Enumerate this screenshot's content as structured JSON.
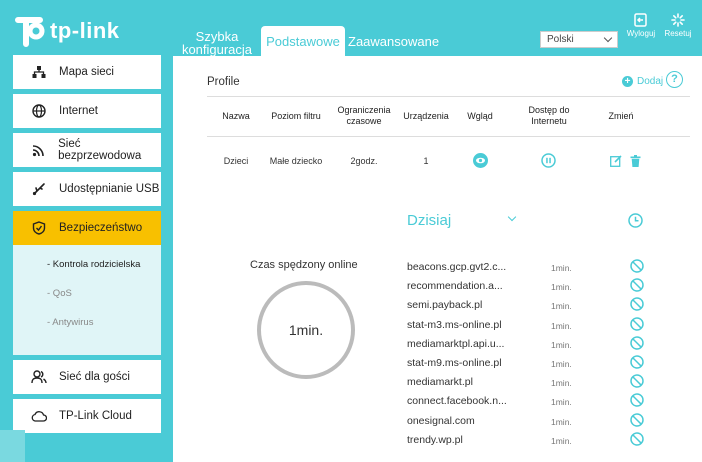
{
  "brand": {
    "name": "tp-link"
  },
  "topnav": {
    "quick_setup": "Szybka konfiguracja",
    "basic": "Podstawowe",
    "advanced": "Zaawansowane"
  },
  "language": {
    "selected": "Polski"
  },
  "header_buttons": {
    "logout": "Wyloguj",
    "reset": "Resetuj"
  },
  "sidebar": {
    "items": [
      {
        "label": "Mapa sieci",
        "icon": "network-map-icon"
      },
      {
        "label": "Internet",
        "icon": "globe-icon"
      },
      {
        "label": "Sieć bezprzewodowa",
        "icon": "wifi-icon"
      },
      {
        "label": "Udostępnianie USB",
        "icon": "usb-icon"
      },
      {
        "label": "Bezpieczeństwo",
        "icon": "shield-icon"
      },
      {
        "label": "Sieć dla gości",
        "icon": "guests-icon"
      },
      {
        "label": "TP-Link Cloud",
        "icon": "cloud-icon"
      }
    ],
    "subitems": [
      "- Kontrola rodzicielska",
      "- QoS",
      "- Antywirus"
    ]
  },
  "profiles": {
    "title": "Profile",
    "add_label": "Dodaj",
    "columns": [
      "Nazwa",
      "Poziom filtru",
      "Ograniczenia czasowe",
      "Urządzenia",
      "Wgląd",
      "Dostęp do Internetu",
      "Zmień"
    ],
    "rows": [
      {
        "name": "Dzieci",
        "filter": "Małe dziecko",
        "time_limit": "2godz.",
        "devices": "1"
      }
    ]
  },
  "insight": {
    "period": "Dzisiaj",
    "time_online_label": "Czas spędzony online",
    "time_online_value": "1min.",
    "sites": [
      {
        "domain": "beacons.gcp.gvt2.c...",
        "duration": "1min."
      },
      {
        "domain": "recommendation.a...",
        "duration": "1min."
      },
      {
        "domain": "semi.payback.pl",
        "duration": "1min."
      },
      {
        "domain": "stat-m3.ms-online.pl",
        "duration": "1min."
      },
      {
        "domain": "mediamarktpl.api.u...",
        "duration": "1min."
      },
      {
        "domain": "stat-m9.ms-online.pl",
        "duration": "1min."
      },
      {
        "domain": "mediamarkt.pl",
        "duration": "1min."
      },
      {
        "domain": "connect.facebook.n...",
        "duration": "1min."
      },
      {
        "domain": "onesignal.com",
        "duration": "1min."
      },
      {
        "domain": "trendy.wp.pl",
        "duration": "1min."
      }
    ]
  },
  "colors": {
    "accent": "#4acbd6",
    "active": "#f8c000",
    "submenu_bg": "#e0f5f7"
  }
}
